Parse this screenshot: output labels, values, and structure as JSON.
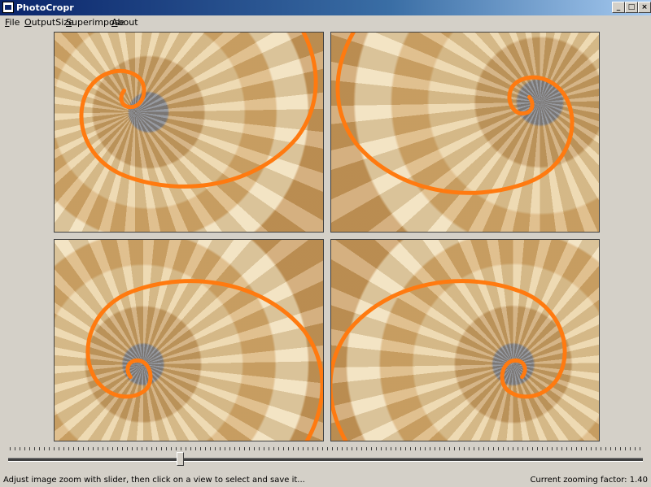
{
  "window": {
    "title": "PhotoCropr",
    "minimize_glyph": "_",
    "maximize_glyph": "□",
    "close_glyph": "×"
  },
  "menu": {
    "items": [
      {
        "first": "F",
        "rest": "ile"
      },
      {
        "first": "O",
        "rest": "utputSize"
      },
      {
        "first": "S",
        "rest": "uperimpose"
      },
      {
        "first": "A",
        "rest": "bout"
      }
    ]
  },
  "views": {
    "overlay_color": "#ff7a10",
    "panels": [
      "top-left",
      "top-right",
      "bottom-left",
      "bottom-right"
    ]
  },
  "zoom_slider": {
    "position_fraction": 0.27
  },
  "status": {
    "hint": "Adjust image zoom with slider, then click on a view to select and save it...",
    "zoom_text": "Current zooming factor: 1.40"
  }
}
